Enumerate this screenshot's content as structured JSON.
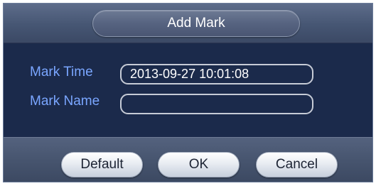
{
  "dialog": {
    "title": "Add Mark"
  },
  "form": {
    "mark_time_label": "Mark Time",
    "mark_time_value": "2013-09-27 10:01:08",
    "mark_name_label": "Mark Name",
    "mark_name_value": ""
  },
  "buttons": {
    "default_label": "Default",
    "ok_label": "OK",
    "cancel_label": "Cancel"
  },
  "colors": {
    "dialog_background": "#1b2a4b",
    "label_text": "#7aa6ff",
    "input_border": "#c6cbd6"
  }
}
